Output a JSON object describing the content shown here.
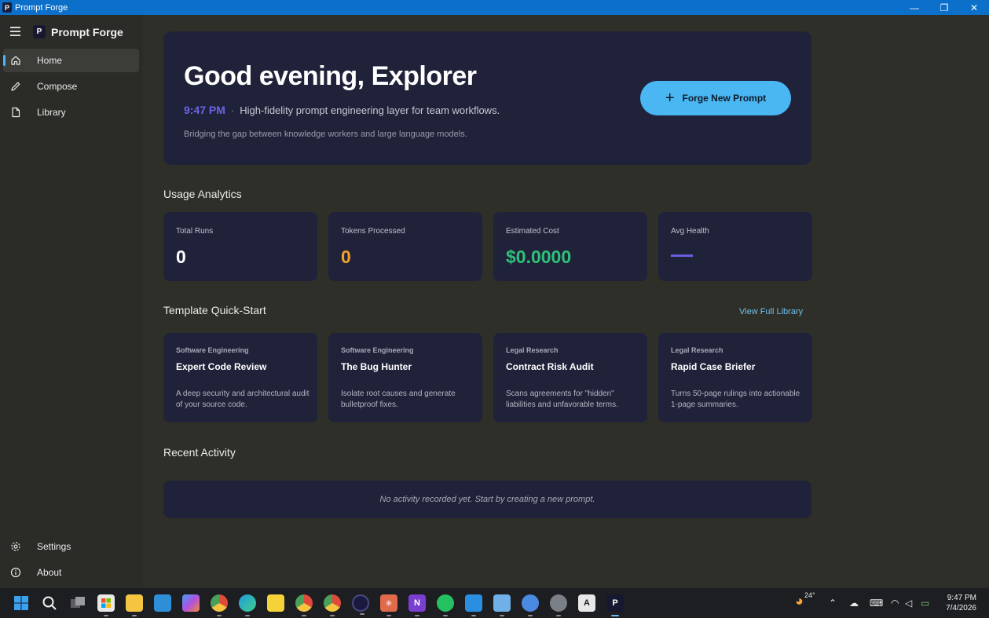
{
  "window": {
    "title": "Prompt Forge",
    "logo_letter": "P",
    "controls": {
      "minimize": "—",
      "restore": "❐",
      "close": "✕"
    }
  },
  "sidebar": {
    "brand": "Prompt Forge",
    "items": [
      {
        "label": "Home",
        "icon": "home-icon",
        "active": true
      },
      {
        "label": "Compose",
        "icon": "pencil-icon",
        "active": false
      },
      {
        "label": "Library",
        "icon": "document-icon",
        "active": false
      }
    ],
    "footer_items": [
      {
        "label": "Settings",
        "icon": "gear-icon"
      },
      {
        "label": "About",
        "icon": "info-icon"
      }
    ]
  },
  "hero": {
    "greeting": "Good evening, Explorer",
    "time": "9:47 PM",
    "separator": "·",
    "tagline": "High-fidelity prompt engineering layer for team workflows.",
    "description": "Bridging the gap between knowledge workers and large language models.",
    "cta_label": "Forge New Prompt",
    "cta_icon": "+"
  },
  "analytics": {
    "title": "Usage Analytics",
    "cards": [
      {
        "label": "Total Runs",
        "value": "0",
        "color": "#ffffff"
      },
      {
        "label": "Tokens Processed",
        "value": "0",
        "color": "#f2a22a"
      },
      {
        "label": "Estimated Cost",
        "value": "$0.0000",
        "color": "#2fc07a"
      },
      {
        "label": "Avg Health",
        "value": "—",
        "color": "#6d63e8"
      }
    ]
  },
  "templates": {
    "title": "Template Quick-Start",
    "view_all_label": "View Full Library",
    "cards": [
      {
        "category": "Software Engineering",
        "name": "Expert Code Review",
        "description": "A deep security and architectural audit of your source code."
      },
      {
        "category": "Software Engineering",
        "name": "The Bug Hunter",
        "description": "Isolate root causes and generate bulletproof fixes."
      },
      {
        "category": "Legal Research",
        "name": "Contract Risk Audit",
        "description": "Scans agreements for \"hidden\" liabilities and unfavorable terms."
      },
      {
        "category": "Legal Research",
        "name": "Rapid Case Briefer",
        "description": "Turns 50-page rulings into actionable 1-page summaries."
      }
    ]
  },
  "activity": {
    "title": "Recent Activity",
    "empty_message": "No activity recorded yet. Start by creating a new prompt."
  },
  "taskbar": {
    "weather_temp": "24°",
    "time": "9:47 PM",
    "date": "7/4/2026",
    "apps": [
      {
        "name": "start-icon",
        "color": "#3aa0f0"
      },
      {
        "name": "search-icon",
        "color": "transparent"
      },
      {
        "name": "task-view-icon",
        "color": "#6b6b70"
      },
      {
        "name": "store-icon",
        "color": "#e8e8e8"
      },
      {
        "name": "file-explorer-icon",
        "color": "#f5c542"
      },
      {
        "name": "calendar-icon",
        "color": "#2e8fd8"
      },
      {
        "name": "copilot-icon",
        "color": "#8a6df0"
      },
      {
        "name": "chrome-icon",
        "color": "#e04a3a"
      },
      {
        "name": "edge-icon",
        "color": "#1f9be0"
      },
      {
        "name": "sticky-notes-icon",
        "color": "#f5d23a"
      },
      {
        "name": "chrome-profile-icon",
        "color": "#e04a3a"
      },
      {
        "name": "chrome-profile-2-icon",
        "color": "#4aa05a"
      },
      {
        "name": "media-icon",
        "color": "#1a1a40"
      },
      {
        "name": "claude-icon",
        "color": "#e06a4a"
      },
      {
        "name": "onenote-icon",
        "color": "#7a3fd0"
      },
      {
        "name": "whatsapp-icon",
        "color": "#25c060"
      },
      {
        "name": "vscode-icon",
        "color": "#2a8fe0"
      },
      {
        "name": "notepad-icon",
        "color": "#6fb0e8"
      },
      {
        "name": "sync-icon",
        "color": "#4a8ae0"
      },
      {
        "name": "settings-app-icon",
        "color": "#7a7f88"
      },
      {
        "name": "app-store-icon",
        "color": "#e8e8e8"
      },
      {
        "name": "prompt-forge-taskbar-icon",
        "color": "#161830"
      }
    ]
  }
}
